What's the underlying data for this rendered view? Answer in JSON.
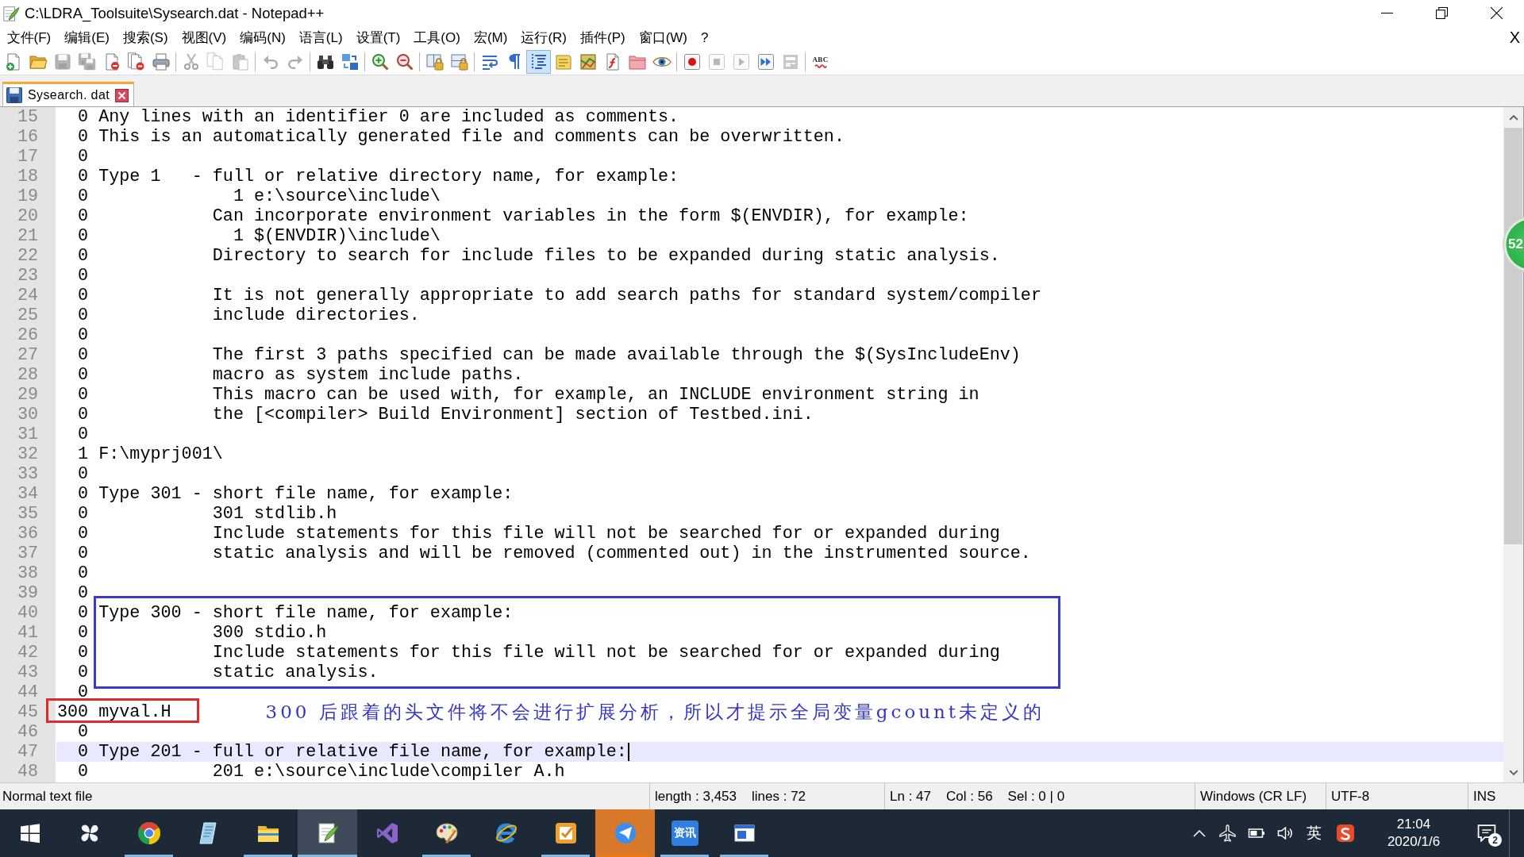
{
  "window": {
    "title": "C:\\LDRA_Toolsuite\\Sysearch.dat - Notepad++"
  },
  "menu": {
    "items": [
      "文件(F)",
      "编辑(E)",
      "搜索(S)",
      "视图(V)",
      "编码(N)",
      "语言(L)",
      "设置(T)",
      "工具(O)",
      "宏(M)",
      "运行(R)",
      "插件(P)",
      "窗口(W)",
      "?"
    ],
    "close_label": "X"
  },
  "toolbar": {
    "groups": [
      [
        {
          "kind": "new",
          "on": false,
          "disabled": false
        },
        {
          "kind": "open",
          "on": false,
          "disabled": false
        },
        {
          "kind": "save",
          "on": false,
          "disabled": true
        },
        {
          "kind": "saveall",
          "on": false,
          "disabled": true
        },
        {
          "kind": "close",
          "on": false,
          "disabled": false
        },
        {
          "kind": "closeall",
          "on": false,
          "disabled": false
        },
        {
          "kind": "print",
          "on": false,
          "disabled": false
        }
      ],
      [
        {
          "kind": "cut",
          "on": false,
          "disabled": true
        },
        {
          "kind": "copy",
          "on": false,
          "disabled": true
        },
        {
          "kind": "paste",
          "on": false,
          "disabled": true
        }
      ],
      [
        {
          "kind": "undo",
          "on": false,
          "disabled": true
        },
        {
          "kind": "redo",
          "on": false,
          "disabled": true
        }
      ],
      [
        {
          "kind": "find",
          "on": false,
          "disabled": false
        },
        {
          "kind": "replace",
          "on": false,
          "disabled": false
        }
      ],
      [
        {
          "kind": "zoomin",
          "on": false,
          "disabled": false
        },
        {
          "kind": "zoomout",
          "on": false,
          "disabled": false
        }
      ],
      [
        {
          "kind": "syncv",
          "on": false,
          "disabled": false
        },
        {
          "kind": "synch",
          "on": false,
          "disabled": false
        }
      ],
      [
        {
          "kind": "wrap",
          "on": false,
          "disabled": false
        },
        {
          "kind": "allchars",
          "on": false,
          "disabled": false
        },
        {
          "kind": "indent",
          "on": true,
          "disabled": false
        },
        {
          "kind": "udl",
          "on": false,
          "disabled": false
        },
        {
          "kind": "docmap",
          "on": false,
          "disabled": false
        },
        {
          "kind": "funclist",
          "on": false,
          "disabled": false
        },
        {
          "kind": "folder",
          "on": false,
          "disabled": false
        },
        {
          "kind": "monitor",
          "on": false,
          "disabled": false
        }
      ],
      [
        {
          "kind": "record",
          "on": false,
          "disabled": false
        },
        {
          "kind": "stop",
          "on": false,
          "disabled": true
        },
        {
          "kind": "play",
          "on": false,
          "disabled": true
        },
        {
          "kind": "playmulti",
          "on": false,
          "disabled": false
        },
        {
          "kind": "savemacro",
          "on": false,
          "disabled": true
        }
      ],
      [
        {
          "kind": "spell",
          "label": "ABC",
          "disabled": false
        }
      ]
    ]
  },
  "tabs": [
    {
      "label": "Sysearch. dat",
      "selected": true
    }
  ],
  "editor": {
    "lines": [
      {
        "kind": "line",
        "number": "15",
        "id": "0",
        "text": "Any lines with an identifier 0 are included as comments.",
        "current": false
      },
      {
        "kind": "line",
        "number": "16",
        "id": "0",
        "text": "This is an automatically generated file and comments can be overwritten.",
        "current": false
      },
      {
        "kind": "line",
        "number": "17",
        "id": "0",
        "current": false
      },
      {
        "kind": "line",
        "number": "18",
        "id": "0",
        "text": "Type 1   - full or relative directory name, for example:",
        "current": false
      },
      {
        "kind": "line",
        "number": "19",
        "id": "0",
        "text": "             1 e:\\source\\include\\",
        "current": false
      },
      {
        "kind": "line",
        "number": "20",
        "id": "0",
        "text": "           Can incorporate environment variables in the form $(ENVDIR), for example:",
        "current": false
      },
      {
        "kind": "line",
        "number": "21",
        "id": "0",
        "text": "             1 $(ENVDIR)\\include\\",
        "current": false
      },
      {
        "kind": "line",
        "number": "22",
        "id": "0",
        "text": "           Directory to search for include files to be expanded during static analysis.",
        "current": false
      },
      {
        "kind": "line",
        "number": "23",
        "id": "0",
        "current": false
      },
      {
        "kind": "line",
        "number": "24",
        "id": "0",
        "text": "           It is not generally appropriate to add search paths for standard system/compiler",
        "current": false
      },
      {
        "kind": "line",
        "number": "25",
        "id": "0",
        "text": "           include directories.",
        "current": false
      },
      {
        "kind": "line",
        "number": "26",
        "id": "0",
        "current": false
      },
      {
        "kind": "line",
        "number": "27",
        "id": "0",
        "text": "           The first 3 paths specified can be made available through the $(SysIncludeEnv)",
        "current": false
      },
      {
        "kind": "line",
        "number": "28",
        "id": "0",
        "text": "           macro as system include paths.",
        "current": false
      },
      {
        "kind": "line",
        "number": "29",
        "id": "0",
        "text": "           This macro can be used with, for example, an INCLUDE environment string in",
        "current": false
      },
      {
        "kind": "line",
        "number": "30",
        "id": "0",
        "text": "           the [<compiler> Build Environment] section of Testbed.ini.",
        "current": false
      },
      {
        "kind": "line",
        "number": "31",
        "id": "0",
        "current": false
      },
      {
        "kind": "line",
        "number": "32",
        "id": "1",
        "text": "F:\\myprj001\\",
        "current": false
      },
      {
        "kind": "line",
        "number": "33",
        "id": "0",
        "current": false
      },
      {
        "kind": "line",
        "number": "34",
        "id": "0",
        "text": "Type 301 - short file name, for example:",
        "current": false
      },
      {
        "kind": "line",
        "number": "35",
        "id": "0",
        "text": "           301 stdlib.h",
        "current": false
      },
      {
        "kind": "line",
        "number": "36",
        "id": "0",
        "text": "           Include statements for this file will not be searched for or expanded during",
        "current": false
      },
      {
        "kind": "line",
        "number": "37",
        "id": "0",
        "text": "           static analysis and will be removed (commented out) in the instrumented source.",
        "current": false
      },
      {
        "kind": "line",
        "number": "38",
        "id": "0",
        "current": false
      },
      {
        "kind": "line",
        "number": "39",
        "id": "0",
        "current": false
      },
      {
        "kind": "group",
        "color": "#3a3ad0",
        "lines": [
          {
            "kind": "line",
            "number": "40",
            "id": "0",
            "text": "Type 300 - short file name, for example:",
            "current": false
          },
          {
            "kind": "line",
            "number": "41",
            "id": "0",
            "text": "           300 stdio.h",
            "current": false
          },
          {
            "kind": "line",
            "number": "42",
            "id": "0",
            "text": "           Include statements for this file will not be searched for or expanded during",
            "current": false
          },
          {
            "kind": "line",
            "number": "43",
            "id": "0",
            "text": "           static analysis.",
            "current": false
          }
        ]
      },
      {
        "kind": "line",
        "number": "44",
        "id": "0",
        "current": false
      },
      {
        "kind": "line",
        "number": "45",
        "id": "300",
        "text": "myval.H",
        "current": false,
        "color": "#e22a2a",
        "note": "300 后跟着的头文件将不会进行扩展分析，所以才提示全局变量gcount未定义的"
      },
      {
        "kind": "line",
        "number": "46",
        "id": "0",
        "current": false
      },
      {
        "kind": "line",
        "number": "47",
        "id": "0",
        "text": "Type 201 - full or relative file name, for example:",
        "current": true
      },
      {
        "kind": "line",
        "number": "48",
        "id": "0",
        "text": "           201 e:\\source\\include\\compiler A.h",
        "current": false
      }
    ]
  },
  "floating_ball": {
    "label": "52"
  },
  "status_bar": {
    "sections": [
      [
        "Normal text file"
      ],
      [
        "length : 3,453",
        "lines : 72"
      ],
      [
        "Ln : 47",
        "Col : 56",
        "Sel : 0 | 0"
      ],
      [
        "Windows (CR LF)"
      ],
      [
        "UTF-8"
      ],
      [
        "INS"
      ]
    ]
  },
  "taskbar": {
    "apps": [
      {
        "kind": "start",
        "running": false,
        "selected": false,
        "attention": false
      },
      {
        "kind": "pinwheel",
        "running": false,
        "selected": false,
        "attention": false
      },
      {
        "kind": "browser",
        "running": true,
        "selected": false,
        "attention": false
      },
      {
        "kind": "notebook",
        "running": false,
        "selected": false,
        "attention": false
      },
      {
        "kind": "explorer",
        "running": true,
        "selected": false,
        "attention": false
      },
      {
        "kind": "notepad",
        "running": true,
        "selected": true,
        "attention": false
      },
      {
        "kind": "ribbon",
        "running": false,
        "selected": false,
        "attention": false
      },
      {
        "kind": "palette",
        "running": true,
        "selected": false,
        "attention": false
      },
      {
        "kind": "ebrowser",
        "running": false,
        "selected": false,
        "attention": false
      },
      {
        "kind": "checklist",
        "running": true,
        "selected": false,
        "attention": false
      },
      {
        "kind": "messenger",
        "running": true,
        "selected": false,
        "attention": true
      },
      {
        "kind": "news",
        "label": "资讯",
        "running": true,
        "selected": false,
        "attention": false
      },
      {
        "kind": "window",
        "running": true,
        "selected": false,
        "attention": false
      }
    ],
    "tray": {
      "input_method": "英",
      "time": "21:04",
      "date": "2020/1/6",
      "notifications": "2"
    }
  }
}
